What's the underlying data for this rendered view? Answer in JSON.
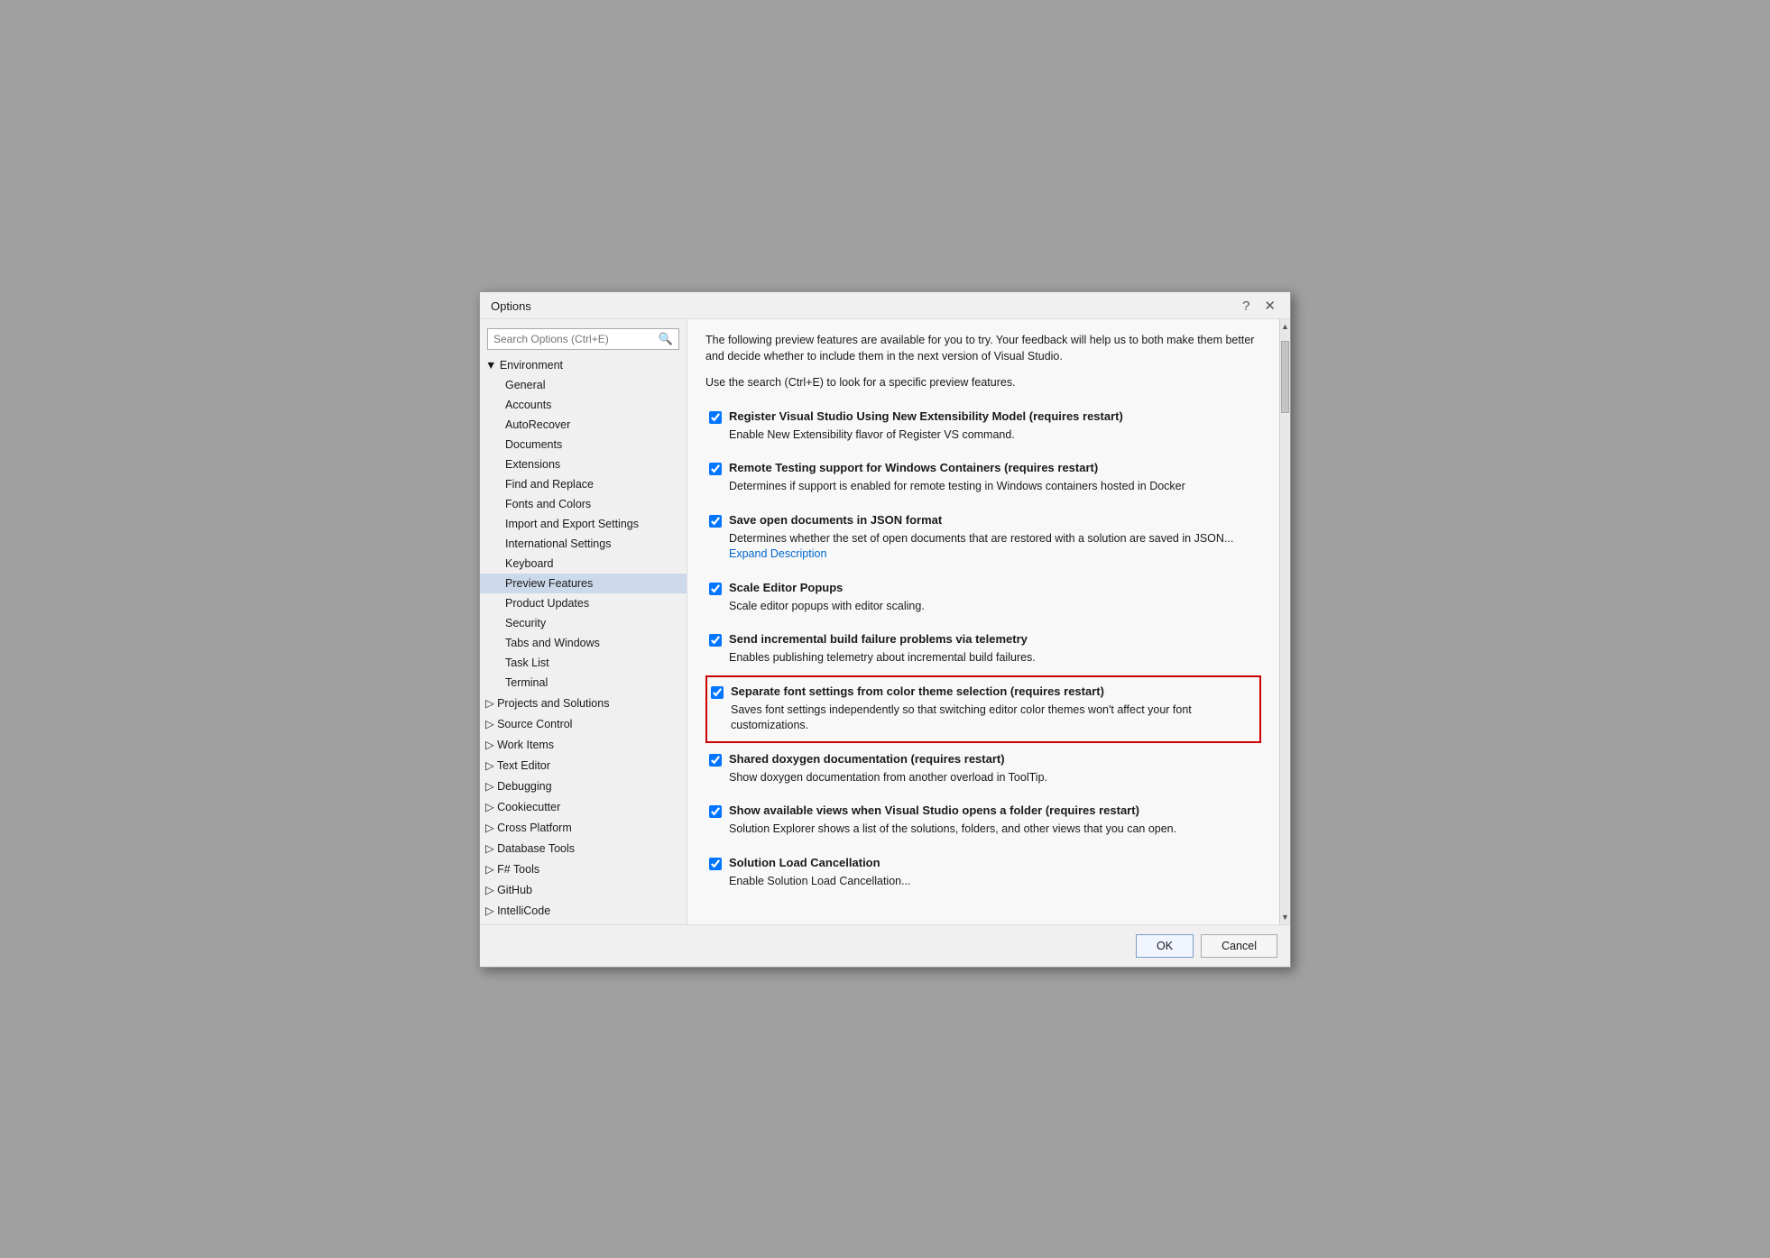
{
  "dialog": {
    "title": "Options",
    "help_btn": "?",
    "close_btn": "✕"
  },
  "search": {
    "placeholder": "Search Options (Ctrl+E)"
  },
  "sidebar": {
    "sections": [
      {
        "id": "environment",
        "label": "▼ Environment",
        "type": "root-expanded",
        "children": [
          {
            "id": "general",
            "label": "General"
          },
          {
            "id": "accounts",
            "label": "Accounts"
          },
          {
            "id": "autorecover",
            "label": "AutoRecover"
          },
          {
            "id": "documents",
            "label": "Documents"
          },
          {
            "id": "extensions",
            "label": "Extensions"
          },
          {
            "id": "find-replace",
            "label": "Find and Replace"
          },
          {
            "id": "fonts-colors",
            "label": "Fonts and Colors"
          },
          {
            "id": "import-export",
            "label": "Import and Export Settings"
          },
          {
            "id": "international",
            "label": "International Settings"
          },
          {
            "id": "keyboard",
            "label": "Keyboard"
          },
          {
            "id": "preview-features",
            "label": "Preview Features",
            "selected": true
          },
          {
            "id": "product-updates",
            "label": "Product Updates"
          },
          {
            "id": "security",
            "label": "Security"
          },
          {
            "id": "tabs-windows",
            "label": "Tabs and Windows"
          },
          {
            "id": "task-list",
            "label": "Task List"
          },
          {
            "id": "terminal",
            "label": "Terminal"
          }
        ]
      },
      {
        "id": "projects",
        "label": "▷ Projects and Solutions",
        "type": "root-collapsed"
      },
      {
        "id": "source-control",
        "label": "▷ Source Control",
        "type": "root-collapsed"
      },
      {
        "id": "work-items",
        "label": "▷ Work Items",
        "type": "root-collapsed"
      },
      {
        "id": "text-editor",
        "label": "▷ Text Editor",
        "type": "root-collapsed"
      },
      {
        "id": "debugging",
        "label": "▷ Debugging",
        "type": "root-collapsed"
      },
      {
        "id": "cookiecutter",
        "label": "▷ Cookiecutter",
        "type": "root-collapsed"
      },
      {
        "id": "cross-platform",
        "label": "▷ Cross Platform",
        "type": "root-collapsed"
      },
      {
        "id": "database-tools",
        "label": "▷ Database Tools",
        "type": "root-collapsed"
      },
      {
        "id": "fsharp-tools",
        "label": "▷ F# Tools",
        "type": "root-collapsed"
      },
      {
        "id": "github",
        "label": "▷ GitHub",
        "type": "root-collapsed"
      },
      {
        "id": "intellicode",
        "label": "▷ IntelliCode",
        "type": "root-collapsed"
      }
    ]
  },
  "content": {
    "intro1": "The following preview features are available for you to try. Your feedback will help us to both make them better and decide whether to include them in the next version of Visual Studio.",
    "intro2": "Use the search (Ctrl+E) to look for a specific preview features.",
    "features": [
      {
        "id": "register-vs",
        "checked": true,
        "title": "Register Visual Studio Using New Extensibility Model (requires restart)",
        "desc": "Enable New Extensibility flavor of Register VS command.",
        "expand": null,
        "highlighted": false
      },
      {
        "id": "remote-testing",
        "checked": true,
        "title": "Remote Testing support for Windows Containers (requires restart)",
        "desc": "Determines if support is enabled for remote testing in Windows containers hosted in Docker",
        "expand": null,
        "highlighted": false
      },
      {
        "id": "save-json",
        "checked": true,
        "title": "Save open documents in JSON format",
        "desc": "Determines whether the set of open documents that are restored with a solution are saved in JSON...",
        "expand": "Expand Description",
        "highlighted": false
      },
      {
        "id": "scale-editor",
        "checked": true,
        "title": "Scale Editor Popups",
        "desc": "Scale editor popups with editor scaling.",
        "expand": null,
        "highlighted": false
      },
      {
        "id": "telemetry",
        "checked": true,
        "title": "Send incremental build failure problems via telemetry",
        "desc": "Enables publishing telemetry about incremental build failures.",
        "expand": null,
        "highlighted": false
      },
      {
        "id": "separate-font",
        "checked": true,
        "title": "Separate font settings from color theme selection (requires restart)",
        "desc": "Saves font settings independently so that switching editor color themes won't affect your font customizations.",
        "expand": null,
        "highlighted": true
      },
      {
        "id": "shared-doxygen",
        "checked": true,
        "title": "Shared doxygen documentation (requires restart)",
        "desc": "Show doxygen documentation from another overload in ToolTip.",
        "expand": null,
        "highlighted": false
      },
      {
        "id": "show-views",
        "checked": true,
        "title": "Show available views when Visual Studio opens a folder (requires restart)",
        "desc": "Solution Explorer shows a list of the solutions, folders, and other views that you can open.",
        "expand": null,
        "highlighted": false
      },
      {
        "id": "solution-load",
        "checked": true,
        "title": "Solution Load Cancellation",
        "desc": "Enable Solution Load Cancellation...",
        "expand": null,
        "highlighted": false
      }
    ]
  },
  "footer": {
    "ok_label": "OK",
    "cancel_label": "Cancel"
  }
}
